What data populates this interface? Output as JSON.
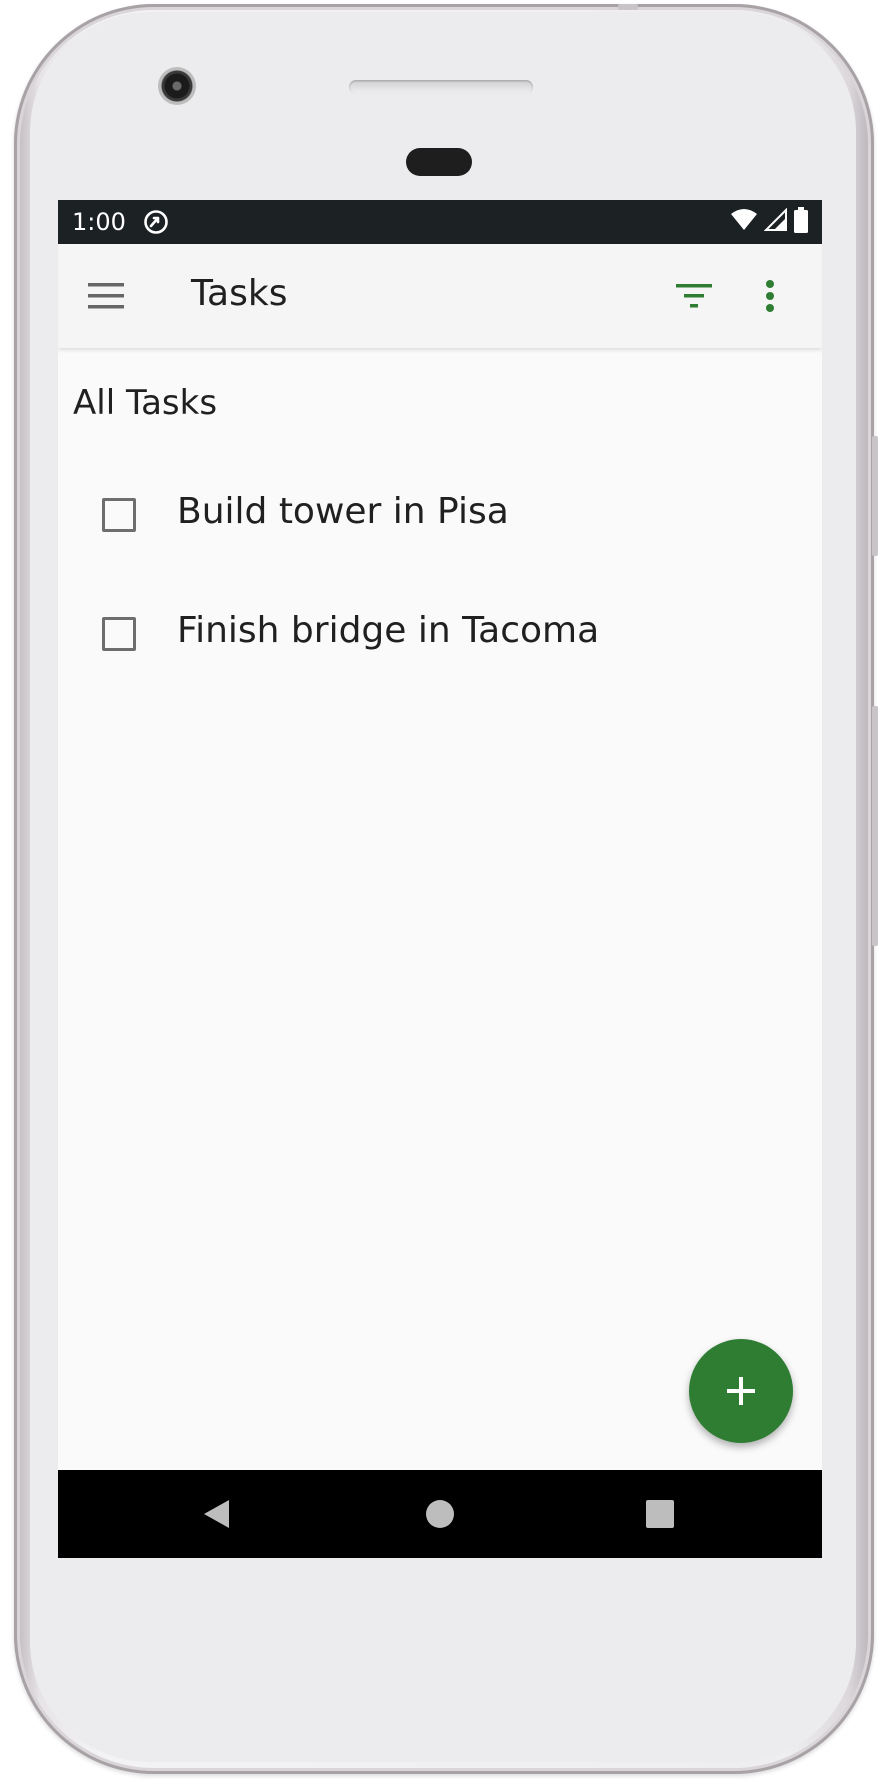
{
  "status_bar": {
    "time": "1:00",
    "app_icon": "sync-icon",
    "wifi_icon": "wifi-icon",
    "signal_icon": "cell-signal-icon",
    "battery_icon": "battery-icon"
  },
  "app_bar": {
    "title": "Tasks",
    "menu_icon": "hamburger-menu-icon",
    "filter_icon": "filter-icon",
    "more_icon": "more-vert-icon"
  },
  "main": {
    "section_title": "All Tasks",
    "tasks": [
      {
        "label": "Build tower in Pisa",
        "completed": false
      },
      {
        "label": "Finish bridge in Tacoma",
        "completed": false
      }
    ],
    "fab_icon": "add-icon"
  },
  "nav_bar": {
    "back_icon": "back-triangle-icon",
    "home_icon": "home-circle-icon",
    "recents_icon": "recents-square-icon"
  },
  "colors": {
    "accent": "#2e7d32",
    "status_bar_bg": "#1c2123",
    "app_bar_bg": "#f5f5f5",
    "screen_bg": "#fafafa",
    "text_primary": "#202020",
    "checkbox_border": "#6e6e6e",
    "nav_bar_bg": "#000000"
  }
}
